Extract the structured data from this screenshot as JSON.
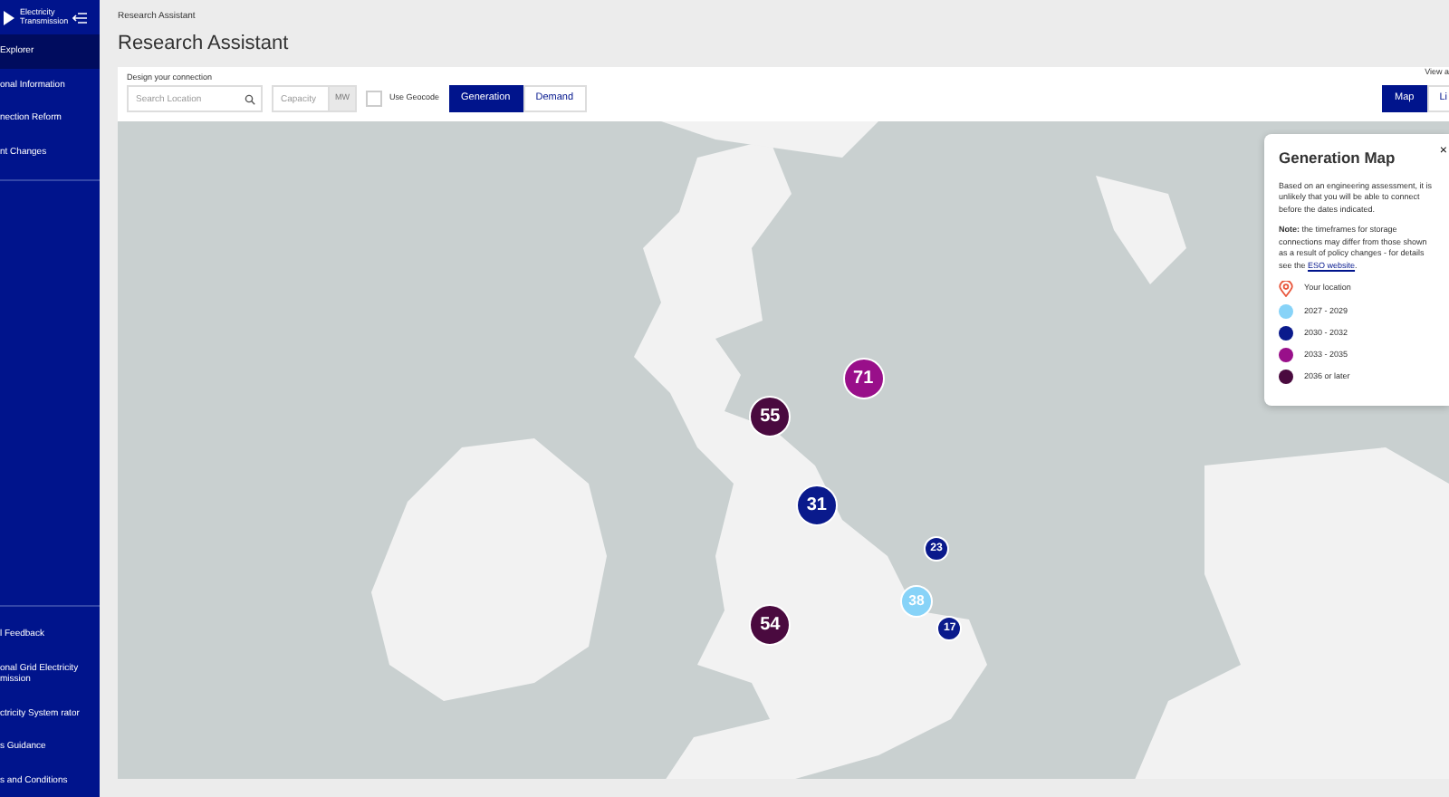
{
  "sidebar": {
    "logo_text": "Electricity Transmission",
    "top_items": [
      {
        "label": "Explorer",
        "selected": true
      },
      {
        "label": "onal Information",
        "selected": false
      },
      {
        "label": "nection Reform",
        "selected": false
      },
      {
        "label": "nt Changes",
        "selected": false
      }
    ],
    "bottom_items": [
      {
        "label": "l Feedback"
      },
      {
        "label": "onal Grid Electricity mission"
      },
      {
        "label": "ctricity System rator"
      },
      {
        "label": "s Guidance"
      },
      {
        "label": "s and Conditions"
      }
    ]
  },
  "breadcrumb": "Research Assistant",
  "title": "Research Assistant",
  "toolbar": {
    "section_label": "Design your connection",
    "search": {
      "placeholder": "Search Location"
    },
    "capacity": {
      "placeholder": "Capacity",
      "unit": "MW"
    },
    "geocode": {
      "label": "Use Geocode",
      "checked": false
    },
    "mode_tabs": [
      {
        "label": "Generation",
        "selected": true
      },
      {
        "label": "Demand",
        "selected": false
      }
    ],
    "view_label": "View a",
    "view_tabs": [
      {
        "label": "Map",
        "selected": true
      },
      {
        "label": "Li",
        "selected": false
      }
    ]
  },
  "map": {
    "clusters": [
      {
        "count": "71",
        "color": "#990f8a"
      },
      {
        "count": "55",
        "color": "#4a0a3f"
      },
      {
        "count": "31",
        "color": "#0a1a8c"
      },
      {
        "count": "23",
        "color": "#0a1a8c"
      },
      {
        "count": "38",
        "color": "#87d3f8"
      },
      {
        "count": "17",
        "color": "#0a1a8c"
      },
      {
        "count": "54",
        "color": "#4a0a3f"
      }
    ]
  },
  "legend": {
    "title": "Generation Map",
    "close": "×",
    "intro": "Based on an engineering assessment, it is unlikely that you will be able to connect before the dates indicated.",
    "note": "**Note:** the timeframes for storage connections may differ from those shown as a result of policy changes - for details see the ",
    "link": "ESO website",
    "note_end": ".",
    "items": [
      {
        "kind": "location",
        "label": "Your location",
        "color": "#e8553a"
      },
      {
        "kind": "dot",
        "label": "2027 - 2029",
        "color": "#87d3f8"
      },
      {
        "kind": "dot",
        "label": "2030 - 2032",
        "color": "#0a1a8c"
      },
      {
        "kind": "dot",
        "label": "2033 - 2035",
        "color": "#990f8a"
      },
      {
        "kind": "dot",
        "label": "2036 or later",
        "color": "#4a0a3f"
      }
    ]
  }
}
